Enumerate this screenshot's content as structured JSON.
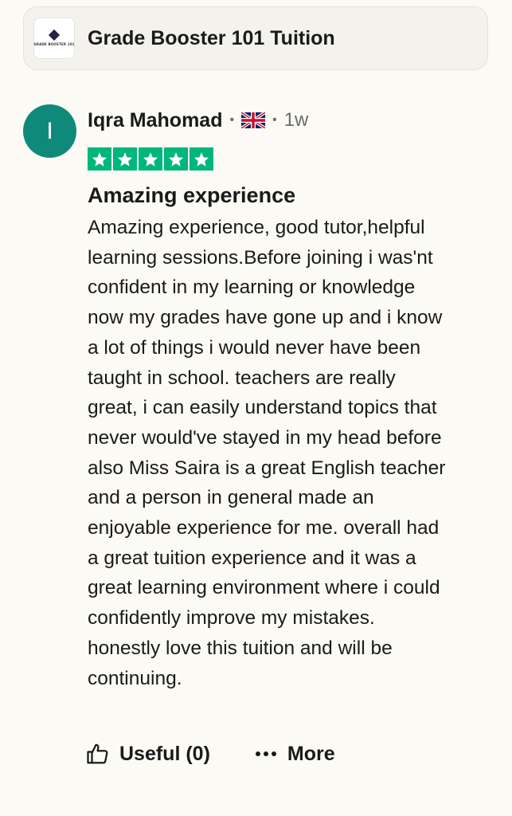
{
  "company": {
    "name": "Grade Booster 101 Tuition",
    "logo_text": "GRADE BOOSTER 101",
    "logo_icon": "company-logo-icon"
  },
  "review": {
    "avatar_letter": "I",
    "avatar_color": "#0f8a7a",
    "reviewer_name": "Iqra Mahomad",
    "separator": "•",
    "country_flag_icon": "uk-flag-icon",
    "time_ago": "1w",
    "rating": 5,
    "rating_max": 5,
    "star_color": "#00b67a",
    "title": "Amazing experience",
    "body_lines": [
      "Amazing experience, good tutor,helpful",
      "learning sessions.Before joining i was'nt",
      "confident in my learning or knowledge",
      "now my grades have gone up and i know",
      "a lot of things i would never have been",
      "taught in school. teachers are really",
      "great, i can easily understand topics that",
      "never would've stayed in my head before",
      "also Miss Saira is a great English teacher",
      "and a person in general made an",
      "enjoyable experience for me. overall had",
      "a great tuition experience and it was a",
      "great learning environment where i could",
      "confidently improve my mistakes.",
      "honestly love this tuition and will be",
      "continuing."
    ]
  },
  "actions": {
    "useful_label": "Useful (0)",
    "useful_icon": "thumbs-up-icon",
    "more_label": "More",
    "more_icon": "ellipsis-icon"
  }
}
